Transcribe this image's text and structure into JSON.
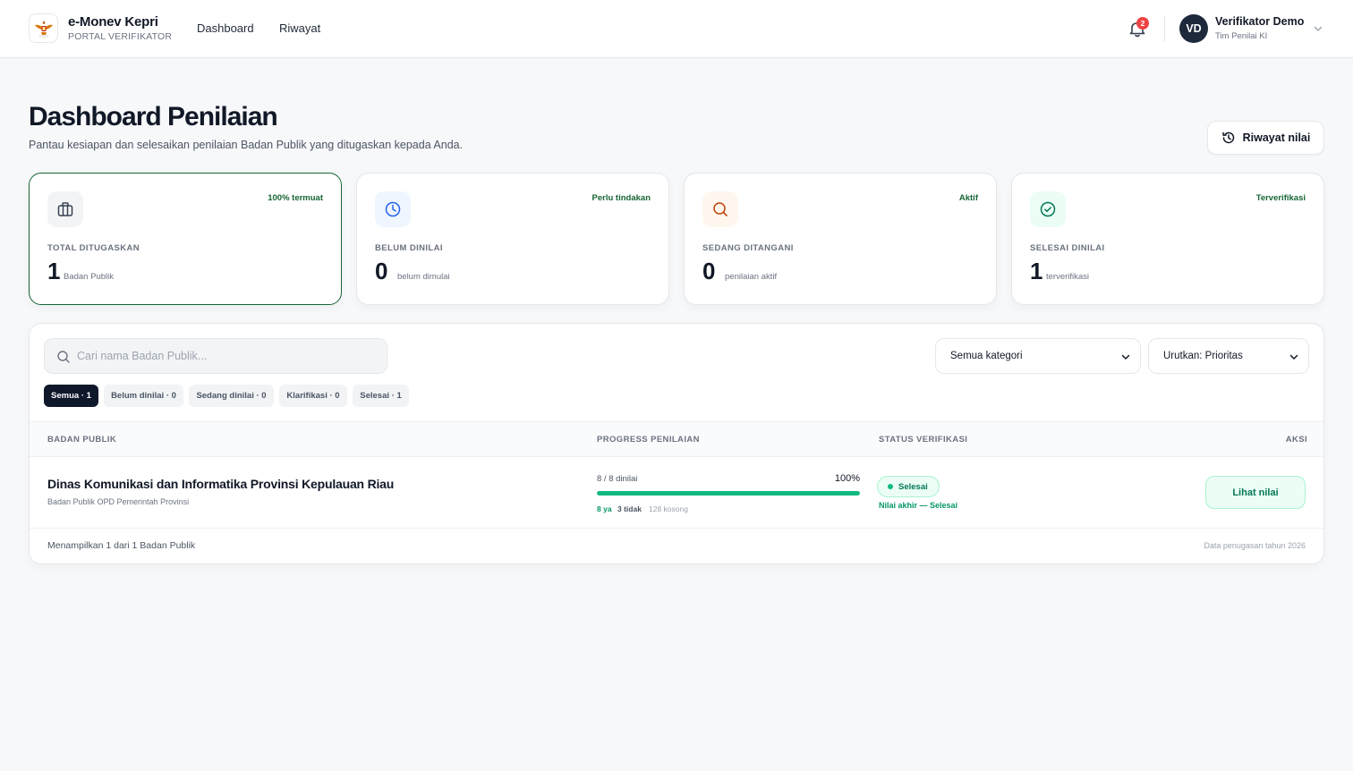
{
  "header": {
    "brand_title": "e-Monev Kepri",
    "brand_subtitle": "PORTAL VERIFIKATOR",
    "nav": [
      {
        "label": "Dashboard"
      },
      {
        "label": "Riwayat"
      }
    ],
    "notification_count": "2",
    "user": {
      "initials": "VD",
      "name": "Verifikator Demo",
      "role": "Tim Penilai KI"
    }
  },
  "page": {
    "title": "Dashboard Penilaian",
    "subtitle": "Pantau kesiapan dan selesaikan penilaian Badan Publik yang ditugaskan kepada Anda.",
    "history_button": "Riwayat nilai"
  },
  "stats": [
    {
      "tag": "100% termuat",
      "label": "TOTAL DITUGASKAN",
      "value": "1",
      "unit": "Badan Publik",
      "icon": "briefcase-icon",
      "icon_color": "#374151",
      "icon_bg": "#f3f4f6"
    },
    {
      "tag": "Perlu tindakan",
      "label": "BELUM DINILAI",
      "value": "0",
      "unit": "belum dimulai",
      "icon": "clock-icon",
      "icon_color": "#2563eb",
      "icon_bg": "#eff6ff"
    },
    {
      "tag": "Aktif",
      "label": "SEDANG DITANGANI",
      "value": "0",
      "unit": "penilaian aktif",
      "icon": "search-icon",
      "icon_color": "#c2410c",
      "icon_bg": "#fff7ed"
    },
    {
      "tag": "Terverifikasi",
      "label": "SELESAI DINILAI",
      "value": "1",
      "unit": "terverifikasi",
      "icon": "check-circle-icon",
      "icon_color": "#047857",
      "icon_bg": "#ecfdf5"
    }
  ],
  "filters": {
    "search_placeholder": "Cari nama Badan Publik...",
    "category_select": "Semua kategori",
    "sort_select": "Urutkan: Prioritas",
    "chips": [
      {
        "label": "Semua · 1",
        "active": true
      },
      {
        "label": "Belum dinilai · 0",
        "active": false
      },
      {
        "label": "Sedang dinilai · 0",
        "active": false
      },
      {
        "label": "Klarifikasi · 0",
        "active": false
      },
      {
        "label": "Selesai · 1",
        "active": false
      }
    ]
  },
  "table": {
    "columns": [
      "BADAN PUBLIK",
      "PROGRESS PENILAIAN",
      "STATUS VERIFIKASI",
      "AKSI"
    ],
    "rows": [
      {
        "name": "Dinas Komunikasi dan Informatika Provinsi Kepulauan Riau",
        "sub": "Badan Publik OPD Pemerintah Provinsi",
        "progress_label": "8 / 8 dinilai",
        "progress_pct": "100%",
        "progress_value": 1.0,
        "meta_ya": "8 ya",
        "meta_tidak": "3 tidak",
        "meta_kosong": "128 kosong",
        "status": "Selesai",
        "status_note": "Nilai akhir — Selesai",
        "action": "Lihat nilai"
      }
    ],
    "footer_left": "Menampilkan 1 dari 1 Badan Publik",
    "footer_right": "Data penugasan tahun 2026"
  },
  "colors": {
    "accent_green": "#166534",
    "success": "#10b981",
    "dark": "#0f172a",
    "badge_red": "#ef4444"
  }
}
